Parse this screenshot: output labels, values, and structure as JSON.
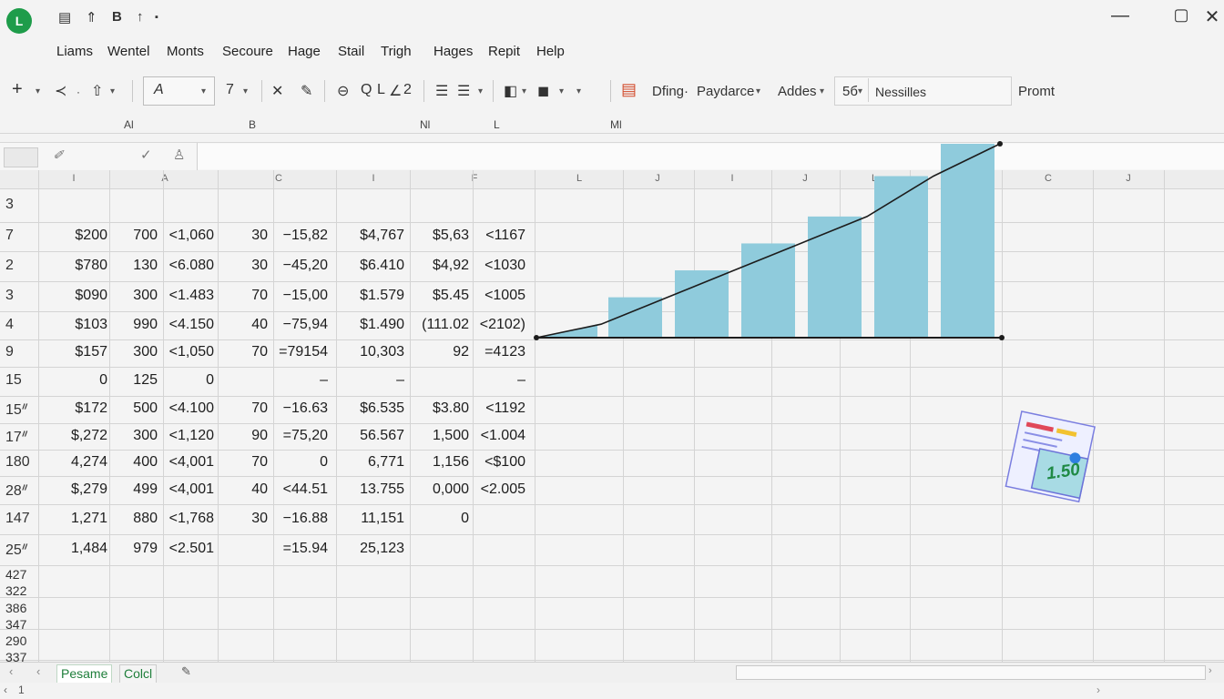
{
  "titlebar": {
    "logo": "L",
    "quick_access": [
      "▤",
      "⇑",
      "B",
      "↑",
      "▪"
    ],
    "minimize": "—",
    "maximize": "▢",
    "close": "✕"
  },
  "menu": [
    "Liams",
    "Wentel",
    "Monts",
    "Secoure",
    "Hage",
    "Stail",
    "Trigh",
    "Hages",
    "Repit",
    "Help"
  ],
  "toolbar": {
    "font_name": "A",
    "font_size": "7",
    "style_label": "Dfing·",
    "style_dropdown": "Paydarce",
    "adds_label": "Addes",
    "number_format": "5б",
    "name_box": "Nessilles",
    "prompt_label": "Promt",
    "group_labels": [
      "Al",
      "B",
      "Nl",
      "L",
      "Ml"
    ]
  },
  "column_headers": [
    "I",
    "A",
    "C",
    "I",
    "F",
    "L",
    "J",
    "I",
    "J",
    "L",
    "C",
    "J"
  ],
  "row_headers": [
    "3",
    "7",
    "2",
    "3",
    "4",
    "9",
    "15",
    "15ᐥ",
    "17ᐥ",
    "180",
    "28ᐥ",
    "147",
    "25ᐥ"
  ],
  "row_headers_small": [
    "427",
    "322",
    "386",
    "347",
    "290",
    "337"
  ],
  "rows": [
    [
      "",
      "",
      "",
      "",
      "",
      "",
      "",
      "",
      ""
    ],
    [
      "$200",
      "700",
      "<1,060",
      "30",
      "−15,82",
      "$4,767",
      "$5,63",
      "<1167"
    ],
    [
      "$780",
      "130",
      "<6.080",
      "30",
      "−45,20",
      "$6.410",
      "$4,92",
      "<1030"
    ],
    [
      "$090",
      "300",
      "<1.483",
      "70",
      "−15,00",
      "$1.579",
      "$5.45",
      "<1005"
    ],
    [
      "$103",
      "990",
      "<4.150",
      "40",
      "−75,94",
      "$1.490",
      "(111.02",
      "<2102)"
    ],
    [
      "$157",
      "300",
      "<1,050",
      "70",
      "=79154",
      "10,303",
      "92",
      "=4123"
    ],
    [
      "0",
      "125",
      "0",
      "",
      "–",
      "–",
      "",
      "–"
    ],
    [
      "$172",
      "500",
      "<4.100",
      "70",
      "−16.63",
      "$6.535",
      "$3.80",
      "<1192"
    ],
    [
      "$,272",
      "300",
      "<1,120",
      "90",
      "=75,20",
      "56.567",
      "1,500",
      "<1.004"
    ],
    [
      "4,274",
      "400",
      "<4,001",
      "70",
      "0",
      "6,771",
      "1,156",
      "<$100"
    ],
    [
      "$,279",
      "499",
      "<4,001",
      "40",
      "<44.51",
      "13.755",
      "0,000",
      "<2.005"
    ],
    [
      "1,271",
      "880",
      "<1,768",
      "30",
      "−16.88",
      "11,151",
      "0",
      ""
    ],
    [
      "1,484",
      "979",
      "<2.501",
      "",
      "=15.94",
      "25,123",
      "",
      ""
    ]
  ],
  "chart_data": {
    "type": "bar",
    "values": [
      5,
      15,
      25,
      35,
      45,
      60,
      72
    ],
    "title": "",
    "xlabel": "",
    "ylabel": ""
  },
  "chart_overlay_value": "1.50",
  "sheet_tabs": [
    "Pesame",
    "Colcl"
  ],
  "status": "1"
}
